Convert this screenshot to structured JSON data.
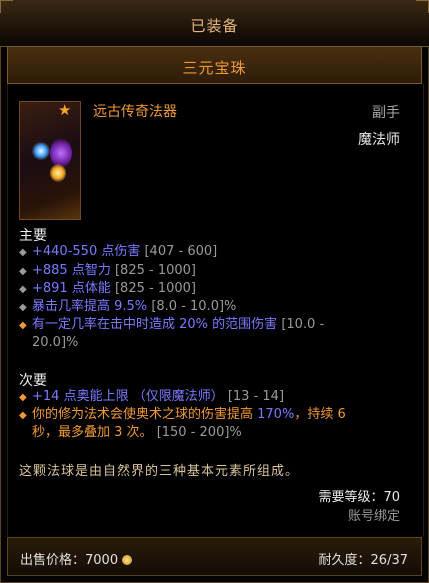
{
  "header": {
    "equipped_label": "已装备"
  },
  "item": {
    "name": "三元宝珠",
    "type": "远古传奇法器",
    "slot": "副手",
    "class": "魔法师",
    "icon": "orb-icon",
    "star_icon": "ancient-star-icon"
  },
  "primary": {
    "label": "主要",
    "stats": [
      {
        "bullet": "◆",
        "value": "+440-550 点伤害",
        "range": "[407 - 600]",
        "style": "blue"
      },
      {
        "bullet": "◆",
        "value": "+885 点智力",
        "range": "[825 - 1000]",
        "style": "blue"
      },
      {
        "bullet": "◆",
        "value": "+891 点体能",
        "range": "[825 - 1000]",
        "style": "blue"
      },
      {
        "bullet": "◆",
        "value": "暴击几率提高 9.5%",
        "range": "[8.0 - 10.0]%",
        "style": "blue"
      },
      {
        "bullet": "◆",
        "value": "有一定几率在击中时造成 20% 的范围伤害",
        "range": "[10.0 -",
        "style": "blue"
      },
      {
        "bullet": "",
        "value": "",
        "range": "20.0]%",
        "style": "blue"
      }
    ]
  },
  "secondary": {
    "label": "次要",
    "stats": [
      {
        "bullet": "◆",
        "value": "+14 点奥能上限 （仅限魔法师）",
        "range": "[13 - 14]"
      }
    ],
    "legendary": {
      "line1_a": "你的修为法术会使奥术之球的伤害提高 ",
      "line1_pct": "170%",
      "line1_b": "，持续 6",
      "line2_a": "秒，最多叠加 3 次。",
      "line2_range": "[150 - 200]%"
    }
  },
  "flavor": "这颗法球是由自然界的三种基本元素所组成。",
  "requirements": {
    "level_label": "需要等级：70",
    "bind": "账号绑定"
  },
  "footer": {
    "sell_label": "出售价格：",
    "sell_value": "7000",
    "durability_label": "耐久度：",
    "durability_value": "26/37"
  },
  "colors": {
    "accent": "#f09a35",
    "magic": "#7a7aff",
    "frame": "#5a4424"
  }
}
